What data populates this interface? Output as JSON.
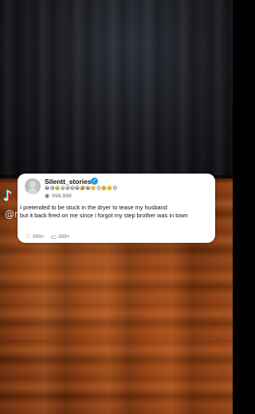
{
  "watermark": {
    "logo_icon": "tiktok-icon",
    "handle": "@r"
  },
  "post": {
    "username": "Silentt_stories",
    "emoji_row": "😂😅🥹😃😆😄😁🤣😭🙂😉🤗🥲😊",
    "views": "999,999",
    "text": "I pretended to be stuck in the dryer to tease my husband\nbut it back fired on me since i forgot my step brother was in town",
    "likes": "999+",
    "comments": "999+"
  },
  "colors": {
    "card_bg": "#ffffff",
    "verified_badge": "#1d9bf0",
    "text": "#111111",
    "meta": "#777777"
  }
}
